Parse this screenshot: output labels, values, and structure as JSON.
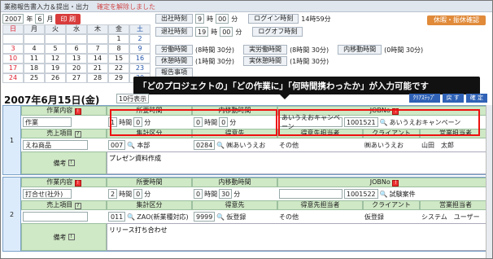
{
  "window": {
    "title": "業務報告書入力＆提出・出力",
    "notice": "確定を解除しました"
  },
  "calendar": {
    "year": "2007",
    "year_unit": "年",
    "month": "6",
    "month_unit": "月",
    "print_label": "印 刷",
    "weekdays": [
      "日",
      "月",
      "火",
      "水",
      "木",
      "金",
      "土"
    ],
    "rows": [
      [
        "",
        "",
        "",
        "",
        "",
        "1",
        "2"
      ],
      [
        "3",
        "4",
        "5",
        "6",
        "7",
        "8",
        "9"
      ],
      [
        "10",
        "11",
        "12",
        "13",
        "14",
        "15",
        "16"
      ],
      [
        "17",
        "18",
        "19",
        "20",
        "21",
        "22",
        "23"
      ],
      [
        "24",
        "25",
        "26",
        "27",
        "28",
        "29",
        "30"
      ]
    ]
  },
  "times": {
    "checkin_label": "出社時刻",
    "checkin_h": "9",
    "checkin_m": "00",
    "h_unit": "時",
    "m_unit": "分",
    "checkout_label": "退社時刻",
    "checkout_h": "19",
    "checkout_m": "00",
    "login_label": "ログイン時刻",
    "login_value": "14時59分",
    "logoff_label": "ログオフ時刻",
    "leave_button": "休暇・振休確認",
    "labor_label": "労働時間",
    "labor_value": "(8時間 30分)",
    "rest_label": "休憩時間",
    "rest_value": "(1時間 30分)",
    "actual_labor_label": "実労働時間",
    "actual_labor_value": "(8時間 30分)",
    "actual_rest_label": "実休憩時間",
    "actual_rest_value": "(1時間 30分)",
    "move_label": "内移動時間",
    "move_value": "(0時間 30分)",
    "report_label": "報告事項"
  },
  "callout": "「どのプロジェクトの」「どの作業に」「何時間携わったか」が入力可能です",
  "datebar": {
    "date": "2007年6月15日(金)",
    "display": "10行表示",
    "buttons": [
      "ｸﾘｱｽﾃｯﾌﾟ",
      "戻 す",
      "確 定"
    ]
  },
  "headers": {
    "work": "作業内容",
    "hours": "所要時間",
    "move": "内移動時間",
    "job": "JOBNo",
    "sales": "売上項目",
    "tally": "集計区分",
    "client": "得意先",
    "client_rep": "得意先担当者",
    "customer": "クライアント",
    "sales_rep": "営業担当者",
    "notes": "備考"
  },
  "records": [
    {
      "num": "1",
      "work": "作業",
      "hours_h": "1",
      "hours_m": "0",
      "move_h": "0",
      "move_m": "0",
      "job_name": "あいうえおキャンペーン",
      "job_no": "1001521",
      "job_label": "あいうえおキャンペーン",
      "sales": "えね商品",
      "tally_code": "007",
      "tally_name": "本部",
      "client_code": "0284",
      "client_name": "㈱あいうえお",
      "client_rep": "その他",
      "customer": "㈱あいうえお",
      "sales_rep": "山田　太郎",
      "notes": "プレゼン資料作成"
    },
    {
      "num": "2",
      "work": "打合せ(社外)",
      "hours_h": "2",
      "hours_m": "0",
      "move_h": "0",
      "move_m": "30",
      "job_name": "",
      "job_no": "1001522",
      "job_label": "試験案件",
      "sales": "",
      "tally_code": "011",
      "tally_name": "ZAO(新業種対応)",
      "client_code": "9999",
      "client_name": "仮登録",
      "client_rep": "その他",
      "customer": "仮登録",
      "sales_rep": "システム　ユーザー",
      "notes": "リリース打ち合わせ"
    }
  ],
  "units": {
    "hour": "時間",
    "minute": "分"
  },
  "colors": {
    "header_green": "#cfe8c5",
    "highlight_red": "#e11111",
    "accent_blue": "#2f62b6"
  }
}
